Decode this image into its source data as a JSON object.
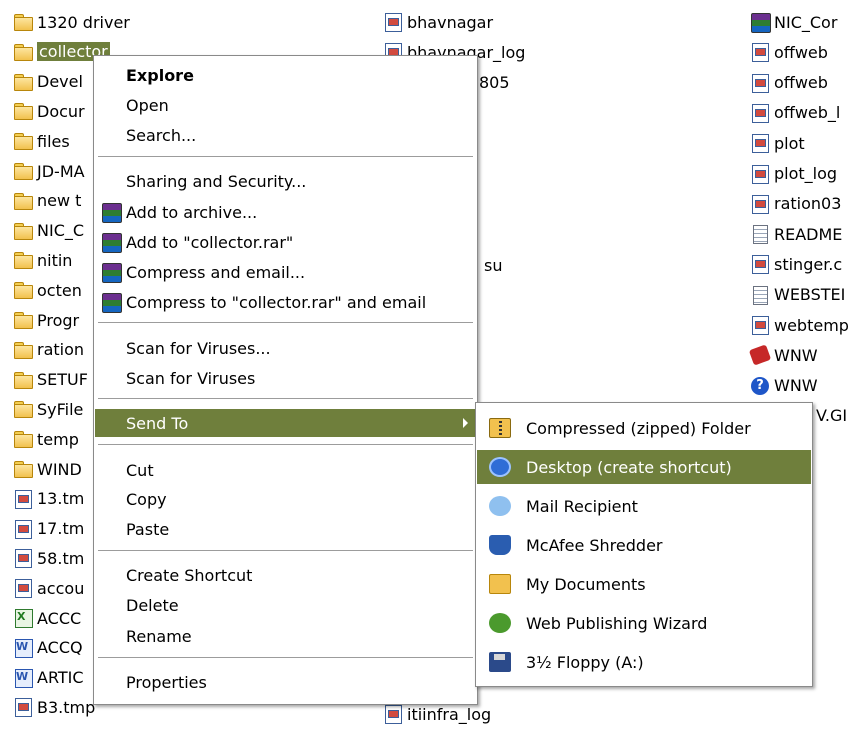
{
  "files": {
    "col1": [
      {
        "label": "1320 driver",
        "icon": "folder-icon"
      },
      {
        "label": "collector",
        "icon": "folder-icon",
        "selected": true
      },
      {
        "label": "Devel",
        "icon": "folder-icon"
      },
      {
        "label": "Docur",
        "icon": "folder-icon"
      },
      {
        "label": "files",
        "icon": "folder-icon"
      },
      {
        "label": "JD-MA",
        "icon": "folder-icon"
      },
      {
        "label": "new t",
        "icon": "folder-icon"
      },
      {
        "label": "NIC_C",
        "icon": "folder-icon"
      },
      {
        "label": "nitin",
        "icon": "folder-icon"
      },
      {
        "label": "octen",
        "icon": "folder-icon"
      },
      {
        "label": "Progr",
        "icon": "folder-icon"
      },
      {
        "label": "ration",
        "icon": "folder-icon"
      },
      {
        "label": "SETUF",
        "icon": "folder-icon"
      },
      {
        "label": "SyFile",
        "icon": "folder-icon"
      },
      {
        "label": "temp",
        "icon": "folder-icon"
      },
      {
        "label": "WIND",
        "icon": "folder-icon"
      },
      {
        "label": "13.tm",
        "icon": "tmp-file-icon"
      },
      {
        "label": "17.tm",
        "icon": "tmp-file-icon"
      },
      {
        "label": "58.tm",
        "icon": "tmp-file-icon"
      },
      {
        "label": "accou",
        "icon": "tmp-file-icon"
      },
      {
        "label": "ACCC",
        "icon": "excel-file-icon"
      },
      {
        "label": "ACCQ",
        "icon": "word-file-icon"
      },
      {
        "label": "ARTIC",
        "icon": "word-file-icon"
      },
      {
        "label": "B3.tmp",
        "icon": "tmp-file-icon"
      }
    ],
    "col2": [
      {
        "label": "bhavnagar",
        "icon": "tmp-file-icon"
      },
      {
        "label": "bhavnagar_log",
        "icon": "tmp-file-icon"
      },
      {
        "label": "805",
        "icon": ""
      },
      {
        "label": "su",
        "icon": ""
      },
      {
        "label": "itiinfra_log",
        "icon": "tmp-file-icon"
      }
    ],
    "col3": [
      {
        "label": "NIC_Cor",
        "icon": "rar-file-icon"
      },
      {
        "label": "offweb",
        "icon": "tmp-file-icon"
      },
      {
        "label": "offweb",
        "icon": "tmp-file-icon"
      },
      {
        "label": "offweb_l",
        "icon": "tmp-file-icon"
      },
      {
        "label": "plot",
        "icon": "tmp-file-icon"
      },
      {
        "label": "plot_log",
        "icon": "tmp-file-icon"
      },
      {
        "label": "ration03",
        "icon": "tmp-file-icon"
      },
      {
        "label": "README",
        "icon": "text-file-icon"
      },
      {
        "label": "stinger.c",
        "icon": "tmp-file-icon"
      },
      {
        "label": "WEBSTEI",
        "icon": "text-file-icon"
      },
      {
        "label": "webtemp",
        "icon": "tmp-file-icon"
      },
      {
        "label": "WNW",
        "icon": "book-icon"
      },
      {
        "label": "WNW",
        "icon": "help-icon"
      },
      {
        "label": "V.GI",
        "icon": ""
      }
    ]
  },
  "context_menu": {
    "explore": "Explore",
    "open": "Open",
    "search": "Search...",
    "sharing": "Sharing and Security...",
    "add_archive": "Add to archive...",
    "add_rar": "Add to \"collector.rar\"",
    "compress_email": "Compress and email...",
    "compress_rar_email": "Compress to \"collector.rar\" and email",
    "scan_for_viruses_dots": "Scan for Viruses...",
    "scan_for_viruses": "Scan for Viruses",
    "send_to": "Send To",
    "cut": "Cut",
    "copy": "Copy",
    "paste": "Paste",
    "create_shortcut": "Create Shortcut",
    "delete": "Delete",
    "rename": "Rename",
    "properties": "Properties"
  },
  "send_to_menu": {
    "compressed_folder": "Compressed (zipped) Folder",
    "desktop": "Desktop (create shortcut)",
    "mail_recipient": "Mail Recipient",
    "mcafee": "McAfee Shredder",
    "my_documents": "My Documents",
    "web_wizard": "Web Publishing Wizard",
    "floppy": "3½ Floppy (A:)"
  },
  "colors": {
    "highlight": "#6f7f3c",
    "menu_bg": "#ffffff"
  }
}
